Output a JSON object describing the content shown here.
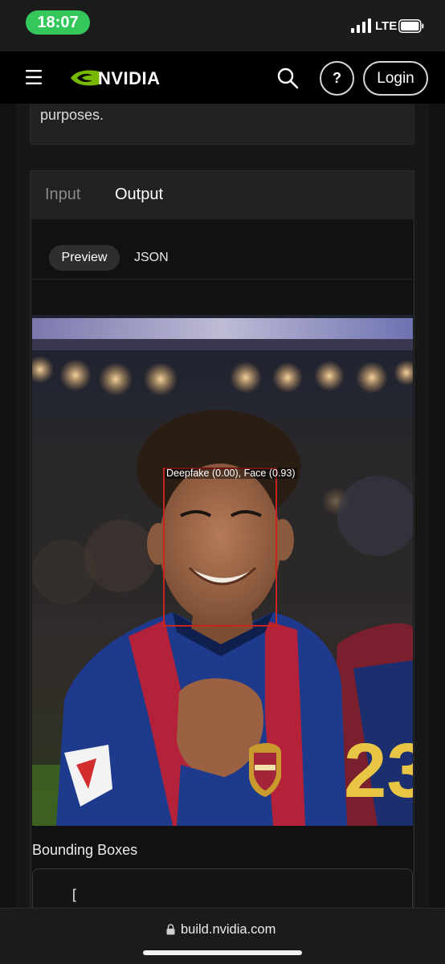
{
  "status_bar": {
    "time": "18:07",
    "network": "LTE",
    "time_pill_color": "#34c759"
  },
  "navbar": {
    "brand": "NVIDIA",
    "brand_color": "#76b900",
    "help_label": "?",
    "login_label": "Login",
    "icons": [
      "menu-icon",
      "nvidia-logo-icon",
      "search-icon"
    ]
  },
  "description": {
    "text_tail": "purposes."
  },
  "panel": {
    "tabs": [
      {
        "label": "Input",
        "active": false
      },
      {
        "label": "Output",
        "active": true
      }
    ],
    "subtabs": [
      {
        "label": "Preview",
        "active": true
      },
      {
        "label": "JSON",
        "active": false
      }
    ],
    "detection_label": "Deepfake (0.00), Face (0.93)",
    "bbox_color": "#c8241f",
    "bounding_boxes_title": "Bounding Boxes",
    "code_first_line": "["
  },
  "browser": {
    "url": "build.nvidia.com"
  }
}
